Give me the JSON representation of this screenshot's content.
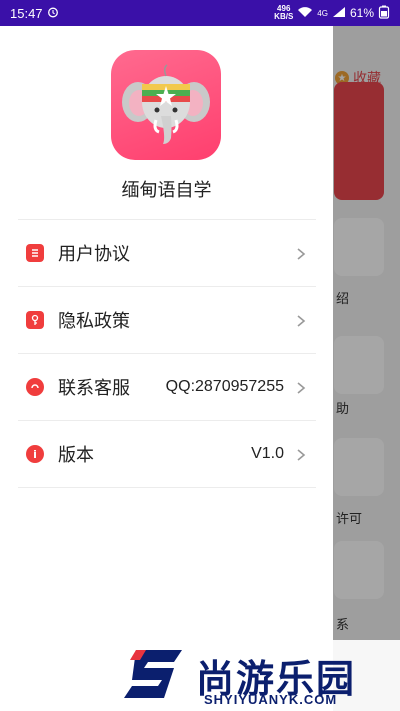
{
  "status_bar": {
    "time": "15:47",
    "net_speed_value": "496",
    "net_speed_unit": "KB/S",
    "network_type": "4G",
    "battery": "61%"
  },
  "background": {
    "favorite_label": "收藏",
    "labels": [
      "绍",
      "助",
      "许可",
      "系"
    ]
  },
  "drawer": {
    "app_name": "缅甸语自学",
    "menu": [
      {
        "label": "用户协议",
        "value": "",
        "icon": "document-icon"
      },
      {
        "label": "隐私政策",
        "value": "",
        "icon": "privacy-key-icon"
      },
      {
        "label": "联系客服",
        "value": "QQ:2870957255",
        "icon": "customer-service-icon"
      },
      {
        "label": "版本",
        "value": "V1.0",
        "icon": "info-icon"
      }
    ]
  },
  "watermark": {
    "cn": "尚游乐园",
    "en": "SHYIYUANYK.COM"
  },
  "colors": {
    "status_bar": "#3a10a8",
    "accent_red": "#f03d3d",
    "logo_pink": "#ff4f7a"
  }
}
